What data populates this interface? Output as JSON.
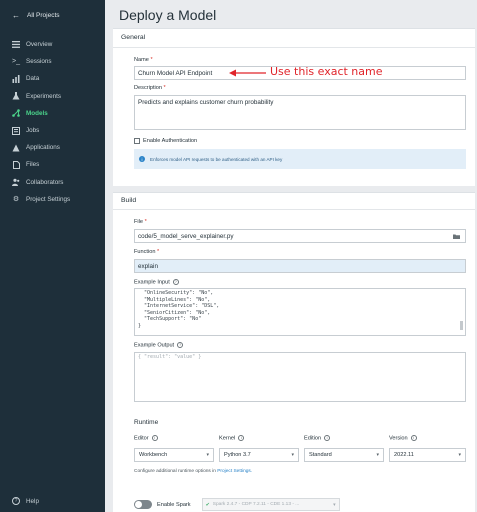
{
  "sidebar": {
    "back_label": "All Projects",
    "items": [
      {
        "label": "Overview",
        "icon": "overview-icon"
      },
      {
        "label": "Sessions",
        "icon": "terminal-icon"
      },
      {
        "label": "Data",
        "icon": "data-icon"
      },
      {
        "label": "Experiments",
        "icon": "experiments-icon"
      },
      {
        "label": "Models",
        "icon": "models-icon",
        "active": true
      },
      {
        "label": "Jobs",
        "icon": "jobs-icon"
      },
      {
        "label": "Applications",
        "icon": "applications-icon"
      },
      {
        "label": "Files",
        "icon": "files-icon"
      },
      {
        "label": "Collaborators",
        "icon": "collaborators-icon"
      },
      {
        "label": "Project Settings",
        "icon": "settings-icon"
      }
    ],
    "help_label": "Help"
  },
  "page": {
    "title": "Deploy a Model"
  },
  "general": {
    "title": "General",
    "name_label": "Name",
    "name_value": "Churn Model API Endpoint",
    "annotation": "Use this exact name",
    "description_label": "Description",
    "description_value": "Predicts and explains customer churn probability",
    "auth_label": "Enable Authentication",
    "auth_info": "Enforces model API requests to be authenticated with an API key"
  },
  "build": {
    "title": "Build",
    "file_label": "File",
    "file_value": "code/5_model_serve_explainer.py",
    "function_label": "Function",
    "function_value": "explain",
    "example_input_label": "Example Input",
    "example_input_lines": [
      "  \"OnlineSecurity\": \"No\",",
      "  \"MultipleLines\": \"No\",",
      "  \"InternetService\": \"DSL\",",
      "  \"SeniorCitizen\": \"No\",",
      "  \"TechSupport\": \"No\"",
      "}"
    ],
    "example_output_label": "Example Output",
    "example_output_value": "{ \"result\": \"value\" }"
  },
  "runtime": {
    "title": "Runtime",
    "editor_label": "Editor",
    "editor_value": "Workbench",
    "kernel_label": "Kernel",
    "kernel_value": "Python 3.7",
    "edition_label": "Edition",
    "edition_value": "Standard",
    "version_label": "Version",
    "version_value": "2022.11",
    "config_text": "Configure additional runtime options in",
    "config_link": "Project Settings.",
    "spark_label": "Enable Spark",
    "spark_value": "Spark 2.4.7 - CDP 7.2.11 - CDE 1.13 - ..."
  },
  "colors": {
    "sidebar_bg": "#1e2f3a",
    "accent_green": "#4bd48b",
    "annotation_red": "#e0242a",
    "info_bg": "#e2eef8"
  }
}
